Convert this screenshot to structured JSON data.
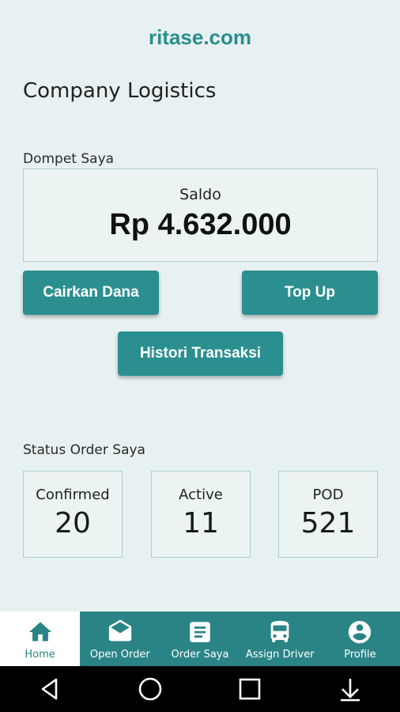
{
  "header": {
    "brand": "ritase.com",
    "company": "Company Logistics"
  },
  "wallet": {
    "section_label": "Dompet Saya",
    "saldo_label": "Saldo",
    "saldo_value": "Rp 4.632.000",
    "buttons": {
      "withdraw": "Cairkan Dana",
      "topup": "Top Up",
      "history": "Histori Transaksi"
    }
  },
  "status": {
    "section_label": "Status Order Saya",
    "items": [
      {
        "label": "Confirmed",
        "count": "20"
      },
      {
        "label": "Active",
        "count": "11"
      },
      {
        "label": "POD",
        "count": "521"
      }
    ]
  },
  "bottom_nav": {
    "items": [
      {
        "label": "Home",
        "icon": "home-icon",
        "active": true
      },
      {
        "label": "Open Order",
        "icon": "envelope-open-icon"
      },
      {
        "label": "Order Saya",
        "icon": "document-icon"
      },
      {
        "label": "Assign Driver",
        "icon": "bus-icon"
      },
      {
        "label": "Profile",
        "icon": "account-circle-icon"
      }
    ]
  },
  "colors": {
    "accent": "#2b8f8f",
    "background": "#e8f1f1",
    "nav_background": "#2a8486"
  },
  "system_nav": {
    "icons": [
      "back-icon",
      "home-circle-icon",
      "recents-icon",
      "download-icon"
    ]
  }
}
